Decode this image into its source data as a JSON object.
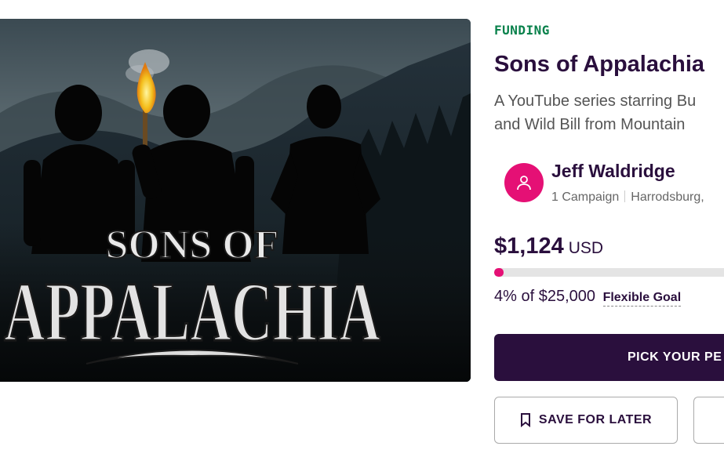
{
  "campaign": {
    "image_title_line1": "SONS OF",
    "image_title_line2": "APPALACHIA",
    "status": "FUNDING",
    "title": "Sons of Appalachia",
    "blurb_line1": "A YouTube series starring Bu",
    "blurb_line2": "and Wild Bill from Mountain"
  },
  "owner": {
    "name": "Jeff Waldridge",
    "campaigns": "1 Campaign",
    "location": "Harrodsburg,",
    "avatar_icon": "user-icon",
    "avatar_color": "#e51075"
  },
  "funding": {
    "amount": "$1,124",
    "currency": "USD",
    "percent_funded": 4,
    "goal_text": "4% of $25,000",
    "goal_type": "Flexible Goal"
  },
  "actions": {
    "pick_perk": "PICK YOUR PE",
    "save_for_later": "SAVE FOR LATER",
    "save_icon": "bookmark-icon"
  },
  "colors": {
    "primary": "#2a0f3d",
    "accent": "#e51075",
    "status": "#08814b"
  }
}
